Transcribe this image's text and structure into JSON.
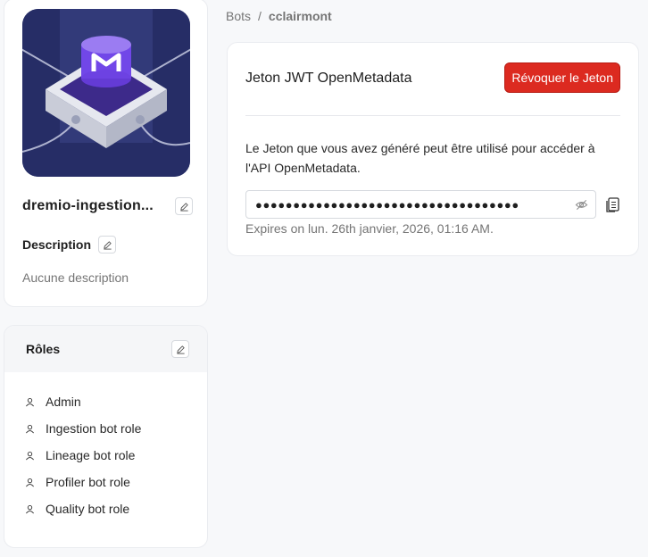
{
  "bot": {
    "name": "dremio-ingestion...",
    "description_label": "Description",
    "description_text": "Aucune description"
  },
  "roles": {
    "title": "Rôles",
    "items": [
      {
        "label": "Admin"
      },
      {
        "label": "Ingestion bot role"
      },
      {
        "label": "Lineage bot role"
      },
      {
        "label": "Profiler bot role"
      },
      {
        "label": "Quality bot role"
      }
    ]
  },
  "breadcrumb": {
    "root": "Bots",
    "separator": "/",
    "current": "cclairmont"
  },
  "token": {
    "title": "Jeton JWT OpenMetadata",
    "revoke_label": "Révoquer le Jeton",
    "description": "Le Jeton que vous avez généré peut être utilisé pour accéder à l'API OpenMetadata.",
    "masked_value": "●●●●●●●●●●●●●●●●●●●●●●●●●●●●●●●●●●●",
    "expiry": "Expires on lun. 26th janvier, 2026, 01:16 AM."
  },
  "colors": {
    "revoke": "#dc2a20",
    "avatar_bg": "#27306b",
    "accent": "#7147e8"
  },
  "icons": [
    "edit-icon",
    "user-icon",
    "eye-off-icon",
    "copy-icon"
  ]
}
